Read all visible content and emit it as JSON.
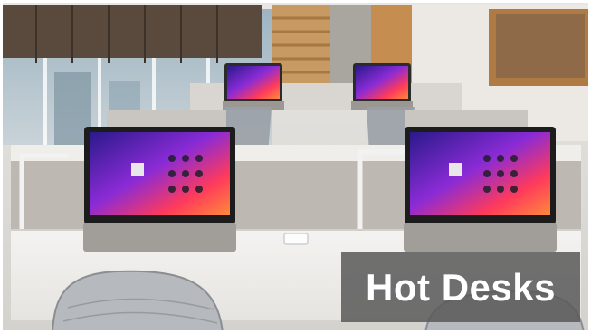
{
  "caption": {
    "text": "Hot Desks"
  }
}
